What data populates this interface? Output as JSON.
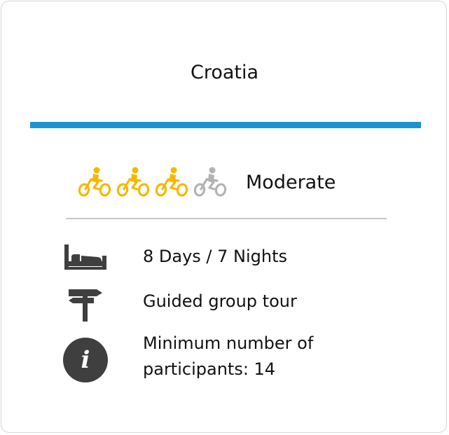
{
  "card": {
    "title": "Croatia",
    "accent_color": "#1b93d3"
  },
  "difficulty": {
    "label": "Moderate",
    "level": 3,
    "max_level": 4,
    "active_color": "#f5b800",
    "inactive_color": "#b3b3b3",
    "icon": "cyclist-icon"
  },
  "details": [
    {
      "icon": "bed-icon",
      "text": "8 Days / 7 Nights"
    },
    {
      "icon": "signpost-icon",
      "text": "Guided group tour"
    },
    {
      "icon": "info-icon",
      "text_line1": "Minimum number of",
      "text_line2": "participants: 14"
    }
  ]
}
